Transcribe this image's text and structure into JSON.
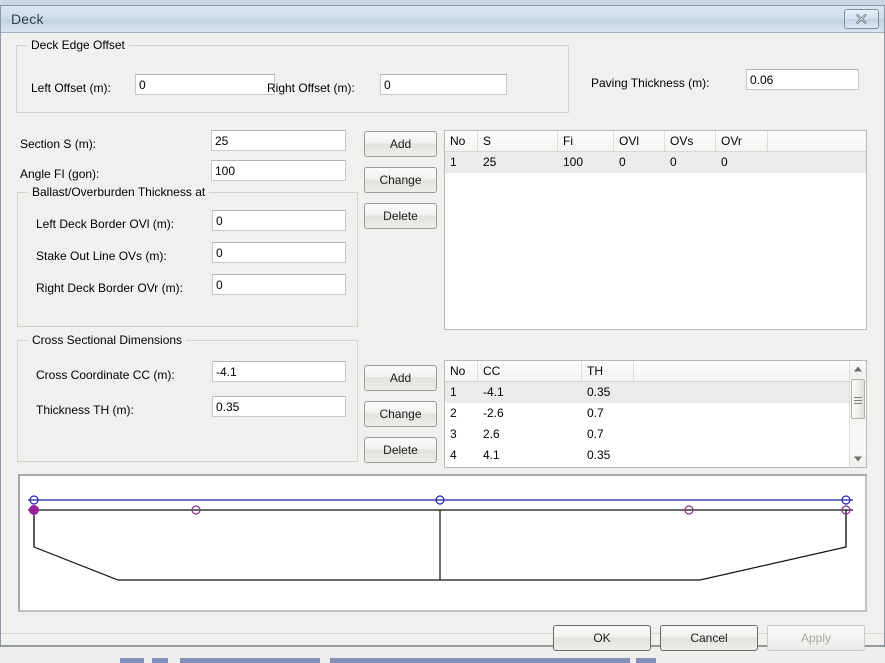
{
  "window": {
    "title": "Deck",
    "close_icon": "close-x-icon"
  },
  "deck_edge_offset": {
    "legend": "Deck Edge Offset",
    "left_offset_label": "Left Offset (m):",
    "left_offset_value": "0",
    "right_offset_label": "Right Offset (m):",
    "right_offset_value": "0"
  },
  "paving": {
    "label": "Paving Thickness (m):",
    "value": "0.06"
  },
  "section": {
    "section_s_label": "Section S (m):",
    "section_s_value": "25",
    "angle_fi_label": "Angle FI (gon):",
    "angle_fi_value": "100",
    "buttons": {
      "add": "Add",
      "change": "Change",
      "delete": "Delete"
    }
  },
  "ballast": {
    "legend": "Ballast/Overburden Thickness at",
    "left_border_label": "Left Deck Border OVl (m):",
    "left_border_value": "0",
    "stake_out_label": "Stake Out Line OVs (m):",
    "stake_out_value": "0",
    "right_border_label": "Right Deck Border OVr (m):",
    "right_border_value": "0"
  },
  "section_table": {
    "columns": [
      "No",
      "S",
      "Fi",
      "OVl",
      "OVs",
      "OVr",
      ""
    ],
    "rows": [
      {
        "cells": [
          "1",
          "25",
          "100",
          "0",
          "0",
          "0",
          ""
        ],
        "selected": true
      }
    ]
  },
  "cross_section": {
    "legend": "Cross Sectional Dimensions",
    "cc_label": "Cross Coordinate CC (m):",
    "cc_value": "-4.1",
    "th_label": "Thickness TH (m):",
    "th_value": "0.35",
    "buttons": {
      "add": "Add",
      "change": "Change",
      "delete": "Delete"
    }
  },
  "cross_table": {
    "columns": [
      "No",
      "CC",
      "TH",
      ""
    ],
    "rows": [
      {
        "cells": [
          "1",
          "-4.1",
          "0.35",
          ""
        ],
        "selected": true
      },
      {
        "cells": [
          "2",
          "-2.6",
          "0.7",
          ""
        ],
        "selected": false
      },
      {
        "cells": [
          "3",
          "2.6",
          "0.7",
          ""
        ],
        "selected": false
      },
      {
        "cells": [
          "4",
          "4.1",
          "0.35",
          ""
        ],
        "selected": false
      }
    ],
    "scrollbar": {
      "up_icon": "scroll-up-arrow-icon",
      "down_icon": "scroll-down-arrow-icon"
    }
  },
  "preview": {
    "name": "deck-cross-section-preview",
    "outline_color": "#000000",
    "guide_line_color": "#2222aa",
    "node_marker_color": "#8b2a8b",
    "filled_node_color": "#9b1f9b"
  },
  "footer": {
    "ok": "OK",
    "cancel": "Cancel",
    "apply": "Apply"
  }
}
